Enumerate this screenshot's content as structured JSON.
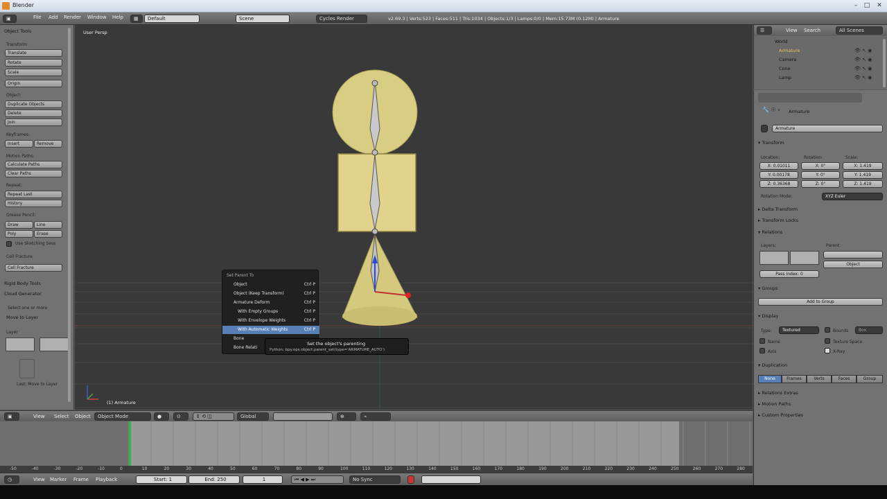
{
  "window": {
    "title": "Blender"
  },
  "topbar": {
    "menus": [
      "File",
      "Add",
      "Render",
      "Window",
      "Help"
    ],
    "layout": "Default",
    "scene": "Scene",
    "engine": "Cycles Render",
    "stats": "v2.69.3 | Verts:523 | Faces:511 | Tris:1034 | Objects:1/3 | Lamps:0/0 | Mem:15.73M (0.12M) | Armature"
  },
  "tools": {
    "header": "Object Tools",
    "transform": "Transform:",
    "translate": "Translate",
    "rotate": "Rotate",
    "scale": "Scale",
    "origin": "Origin",
    "object": "Object:",
    "duplicate": "Duplicate Objects",
    "delete": "Delete",
    "join": "Join",
    "keyframes": "Keyframes:",
    "insert": "Insert",
    "remove": "Remove",
    "motionpaths": "Motion Paths:",
    "calcpaths": "Calculate Paths",
    "clearpaths": "Clear Paths",
    "repeat": "Repeat:",
    "repeatlast": "Repeat Last",
    "history": "History",
    "grease": "Grease Pencil:",
    "draw": "Draw",
    "line": "Line",
    "poly": "Poly",
    "erase": "Erase",
    "sketch": "Use Sketching Sess",
    "cellfracture": "Cell Fracture",
    "cellbtn": "Cell Fracture",
    "rigid": "Rigid Body Tools",
    "cloud": "Cloud Generator",
    "selectone": "Select one or more",
    "move": "Move to Layer",
    "layer": "Layer",
    "lastop": "Last: Move to Layer"
  },
  "viewport": {
    "header": "User Persp",
    "footer": "(1) Armature"
  },
  "popup": {
    "title": "Set Parent To",
    "items": [
      {
        "label": "Object",
        "shortcut": "Ctrl P"
      },
      {
        "label": "Object (Keep Transform)",
        "shortcut": "Ctrl P"
      },
      {
        "label": "Armature Deform",
        "shortcut": "Ctrl P"
      },
      {
        "label": "With Empty Groups",
        "shortcut": "Ctrl P"
      },
      {
        "label": "With Envelope Weights",
        "shortcut": "Ctrl P"
      },
      {
        "label": "With Automatic Weights",
        "shortcut": "Ctrl P"
      },
      {
        "label": "Bone",
        "shortcut": ""
      },
      {
        "label": "Bone Relati",
        "shortcut": ""
      }
    ]
  },
  "tooltip": {
    "title": "Set the object's parenting",
    "python": "Python: bpy.ops.object.parent_set(type='ARMATURE_AUTO')"
  },
  "timeline_header": {
    "view": "View",
    "select": "Select",
    "object": "Object",
    "mode": "Object Mode",
    "orientation": "Global"
  },
  "timeline": {
    "ticks": [
      "-50",
      "-40",
      "-30",
      "-20",
      "-10",
      "0",
      "10",
      "20",
      "30",
      "40",
      "50",
      "60",
      "70",
      "80",
      "90",
      "100",
      "110",
      "120",
      "130",
      "140",
      "150",
      "160",
      "170",
      "180",
      "190",
      "200",
      "210",
      "220",
      "230",
      "240",
      "250",
      "260",
      "270",
      "280"
    ]
  },
  "timeline_footer": {
    "view": "View",
    "marker": "Marker",
    "frame": "Frame",
    "playback": "Playback",
    "start": "Start: 1",
    "end": "End: 250",
    "current": "1",
    "sync": "No Sync"
  },
  "outliner": {
    "view": "View",
    "search": "Search",
    "scenes": "All Scenes",
    "items": [
      "World",
      "Armature",
      "Camera",
      "Cone",
      "Lamp"
    ]
  },
  "props": {
    "context": "Armature",
    "name": "Armature",
    "transform": "Transform",
    "location": "Location:",
    "rotation": "Rotation:",
    "scale": "Scale:",
    "loc": [
      "X: 0.01011",
      "Y: 0.00178",
      "Z: 0.36368"
    ],
    "rot": [
      "X: 0°",
      "Y: 0°",
      "Z: 0°"
    ],
    "scl": [
      "X: 1.419",
      "Y: 1.419",
      "Z: 1.419"
    ],
    "rotmode_label": "Rotation Mode:",
    "rotmode": "XYZ Euler",
    "delta": "Delta Transform",
    "locks": "Transform Locks",
    "relations": "Relations",
    "layers": "Layers:",
    "parent": "Parent:",
    "parent_type": "Object",
    "passindex": "Pass Index: 0",
    "groups": "Groups",
    "addgroup": "Add to Group",
    "display": "Display",
    "type_label": "Type:",
    "type": "Textured",
    "bounds": "Bounds",
    "box": "Box",
    "name_chk": "Name",
    "texspace": "Texture Space",
    "axis": "Axis",
    "xray": "X-Ray",
    "duplication": "Duplication",
    "dup_tabs": [
      "None",
      "Frames",
      "Verts",
      "Faces",
      "Group"
    ],
    "relextras": "Relations Extras",
    "motion": "Motion Paths",
    "custom": "Custom Properties"
  }
}
